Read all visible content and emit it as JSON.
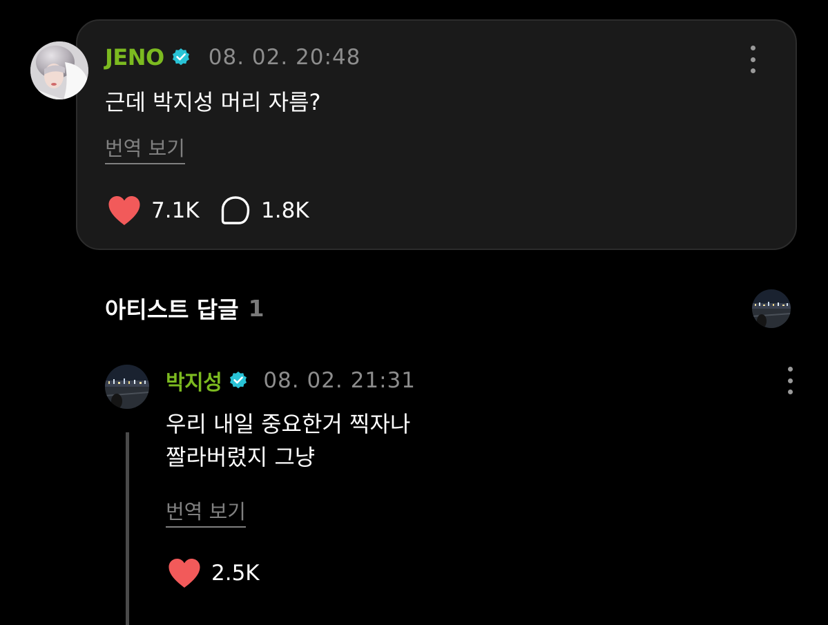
{
  "colors": {
    "background": "#000000",
    "card": "#1a1a1a",
    "username_green": "#7cba20",
    "verified_teal": "#29c3d6",
    "muted_text": "#8d8d8d",
    "heart_red": "#f25a5a"
  },
  "post": {
    "avatar": "user-avatar-photo",
    "author": "JENO",
    "verified_icon": "verified-badge-icon",
    "timestamp": "08. 02. 20:48",
    "more_icon": "more-vertical-icon",
    "text": "근데 박지성 머리 자름?",
    "translate_label": "번역 보기",
    "likes_icon": "heart-icon",
    "likes": "7.1K",
    "comments_icon": "comment-bubble-icon",
    "comments": "1.8K"
  },
  "artist_replies": {
    "title": "아티스트 답글",
    "count": "1",
    "header_avatar": "artist-avatar-photo"
  },
  "reply": {
    "avatar": "artist-avatar-photo",
    "author": "박지성",
    "verified_icon": "verified-badge-icon",
    "timestamp": "08. 02. 21:31",
    "more_icon": "more-vertical-icon",
    "text_lines": [
      "우리 내일 중요한거 찍자나",
      "짤라버렸지 그냥"
    ],
    "translate_label": "번역 보기",
    "likes_icon": "heart-icon",
    "likes": "2.5K"
  }
}
